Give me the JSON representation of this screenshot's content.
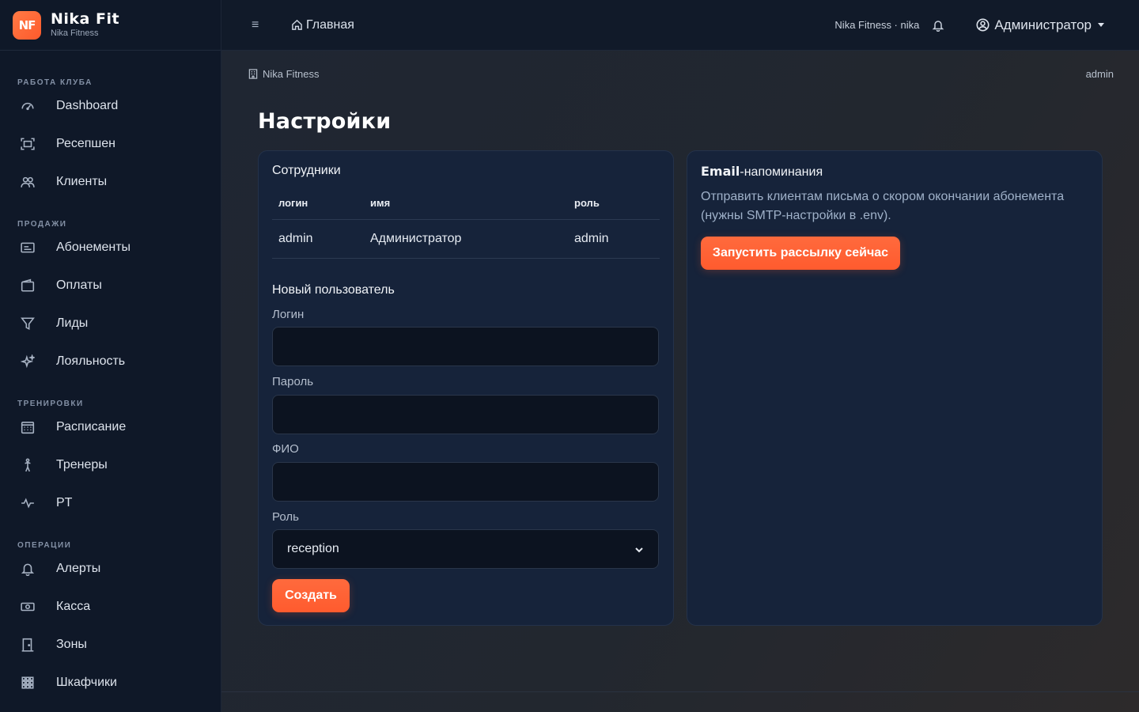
{
  "brand": {
    "logo": "NF",
    "title": "Nika Fit",
    "subtitle": "Nika Fitness"
  },
  "sidebar": {
    "sections": [
      {
        "title": "РАБОТА КЛУБА",
        "items": [
          {
            "label": "Dashboard",
            "icon": "speedometer-icon"
          },
          {
            "label": "Ресепшен",
            "icon": "scan-icon"
          },
          {
            "label": "Клиенты",
            "icon": "people-icon"
          }
        ]
      },
      {
        "title": "ПРОДАЖИ",
        "items": [
          {
            "label": "Абонементы",
            "icon": "card-icon"
          },
          {
            "label": "Оплаты",
            "icon": "wallet-icon"
          },
          {
            "label": "Лиды",
            "icon": "funnel-icon"
          },
          {
            "label": "Лояльность",
            "icon": "stars-icon"
          }
        ]
      },
      {
        "title": "ТРЕНИРОВКИ",
        "items": [
          {
            "label": "Расписание",
            "icon": "calendar-icon"
          },
          {
            "label": "Тренеры",
            "icon": "person-running-icon"
          },
          {
            "label": "PT",
            "icon": "activity-icon"
          }
        ]
      },
      {
        "title": "ОПЕРАЦИИ",
        "items": [
          {
            "label": "Алерты",
            "icon": "bell-icon"
          },
          {
            "label": "Касса",
            "icon": "cash-icon"
          },
          {
            "label": "Зоны",
            "icon": "door-icon"
          },
          {
            "label": "Шкафчики",
            "icon": "grid-icon"
          }
        ]
      }
    ]
  },
  "topbar": {
    "home_label": "Главная",
    "club_label": "Nika Fitness · nika",
    "user_label": "Администратор"
  },
  "breadcrumb": {
    "club": "Nika Fitness",
    "user": "admin"
  },
  "page": {
    "title": "Настройки"
  },
  "staff": {
    "title": "Сотрудники",
    "columns": [
      "логин",
      "имя",
      "роль"
    ],
    "rows": [
      {
        "login": "admin",
        "name": "Администратор",
        "role": "admin"
      }
    ]
  },
  "new_user_form": {
    "title": "Новый пользователь",
    "login_label": "Логин",
    "login_value": "",
    "password_label": "Пароль",
    "password_value": "",
    "fio_label": "ФИО",
    "fio_value": "",
    "role_label": "Роль",
    "role_value": "reception",
    "submit_label": "Создать"
  },
  "email_reminders": {
    "title_bold": "Email",
    "title_rest": "-напоминания",
    "description": "Отправить клиентам письма о скором окончании абонемента (нужны SMTP-настройки в .env).",
    "button_label": "Запустить рассылку сейчас"
  },
  "colors": {
    "accent": "#ff5f33",
    "sidebar_bg": "#0f1828",
    "card_bg": "#16233a"
  }
}
